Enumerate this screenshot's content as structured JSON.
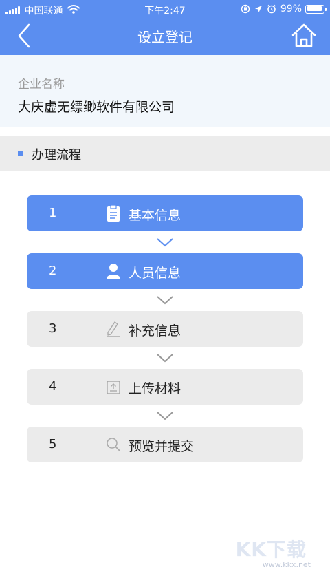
{
  "status_bar": {
    "carrier": "中国联通",
    "time": "下午2:47",
    "battery": "99%"
  },
  "nav": {
    "title": "设立登记",
    "back_icon": "chevron-left-icon",
    "home_icon": "home-icon"
  },
  "company": {
    "label": "企业名称",
    "value": "大庆虚无缥缈软件有限公司"
  },
  "section": {
    "title": "办理流程"
  },
  "steps": [
    {
      "number": "1",
      "label": "基本信息",
      "icon": "clipboard-icon",
      "active": true
    },
    {
      "number": "2",
      "label": "人员信息",
      "icon": "person-icon",
      "active": true
    },
    {
      "number": "3",
      "label": "补充信息",
      "icon": "pen-icon",
      "active": false
    },
    {
      "number": "4",
      "label": "上传材料",
      "icon": "upload-icon",
      "active": false
    },
    {
      "number": "5",
      "label": "预览并提交",
      "icon": "search-icon",
      "active": false
    }
  ],
  "watermark": {
    "logo": "KK下载",
    "url": "www.kkx.net"
  },
  "colors": {
    "primary": "#5b8ef0",
    "inactive_step": "#ebebeb",
    "company_bg": "#f2f7fc",
    "section_bg": "#ececec"
  }
}
